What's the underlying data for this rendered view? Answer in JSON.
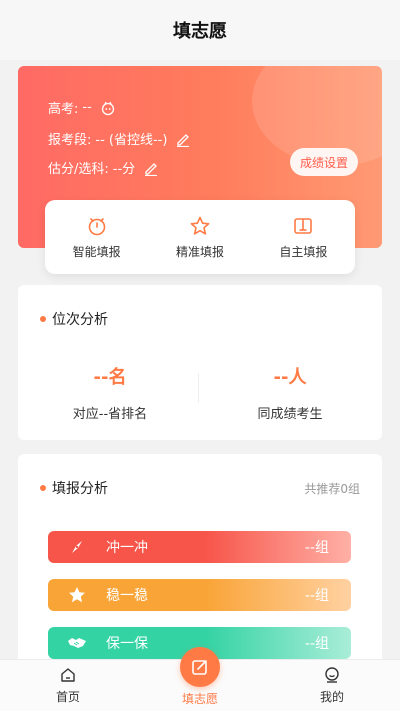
{
  "header": {
    "title": "填志愿"
  },
  "hero": {
    "exam_label": "高考:",
    "exam_value": "--",
    "segment_label": "报考段:",
    "segment_value": "-- (省控线--)",
    "score_label": "估分/选科:",
    "score_value": "--分",
    "score_button": "成绩设置"
  },
  "modes": [
    {
      "label": "智能填报",
      "icon": "timer-icon"
    },
    {
      "label": "精准填报",
      "icon": "star-icon"
    },
    {
      "label": "自主填报",
      "icon": "book-icon"
    }
  ],
  "rank_analysis": {
    "title": "位次分析",
    "rank_value": "--名",
    "rank_desc": "对应--省排名",
    "peers_value": "--人",
    "peers_desc": "同成绩考生"
  },
  "fill_analysis": {
    "title": "填报分析",
    "recommend": "共推荐0组",
    "tiers": [
      {
        "label": "冲一冲",
        "value": "--组",
        "icon": "compass-icon",
        "color": "#f7554a"
      },
      {
        "label": "稳一稳",
        "value": "--组",
        "icon": "star-icon",
        "color": "#f9a437"
      },
      {
        "label": "保一保",
        "value": "--组",
        "icon": "handshake-icon",
        "color": "#34d3a4"
      }
    ]
  },
  "tabbar": {
    "home": "首页",
    "center": "填志愿",
    "me": "我的"
  },
  "colors": {
    "accent": "#ff7a45",
    "hero_start": "#ff6a64",
    "hero_end": "#ff9a74"
  }
}
